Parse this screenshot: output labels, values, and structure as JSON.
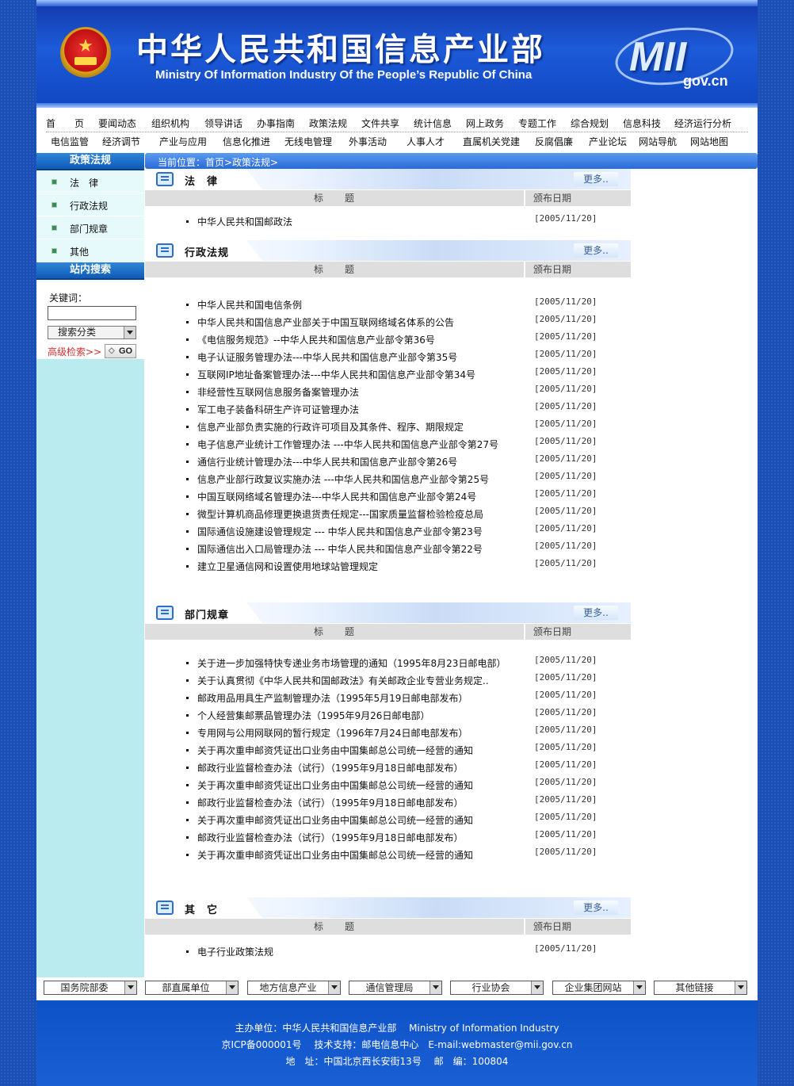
{
  "header": {
    "title_cn": "中华人民共和国信息产业部",
    "title_en": "Ministry Of Information Industry Of the People’s  Republic Of China",
    "logo_text": "MII",
    "logo_domain": "gov.cn"
  },
  "nav": {
    "row1": [
      "首　　页",
      "要闻动态",
      "组织机构",
      "领导讲话",
      "办事指南",
      "政策法规",
      "文件共享",
      "统计信息",
      "网上政务",
      "专题工作",
      "综合规划",
      "信息科技",
      "经济运行分析"
    ],
    "row2": [
      "电信监管",
      "经济调节",
      "产业与应用",
      "信息化推进",
      "无线电管理",
      "外事活动",
      "人事人才",
      "直属机关党建",
      "反腐倡廉",
      "产业论坛",
      "网站导航",
      "网站地图"
    ]
  },
  "breadcrumb": "当前位置：首页>政策法规>",
  "sidebar": {
    "policy_title": "政策法规",
    "items": [
      "法　律",
      "行政法规",
      "部门规章",
      "其他"
    ],
    "search_title": "站内搜索",
    "keyword_label": "关键词：",
    "keyword_value": "",
    "category_select": "搜索分类",
    "advanced_link": "高级检索>>",
    "go_label": "GO"
  },
  "columns": {
    "title": "标　　题",
    "date": "颁布日期"
  },
  "more_label": "更多..",
  "sections": {
    "law": {
      "title": "法　律",
      "rows": [
        {
          "title": "中华人民共和国邮政法",
          "date": "[2005/11/20]"
        }
      ]
    },
    "admin": {
      "title": "行政法规",
      "rows": [
        {
          "title": "中华人民共和国电信条例",
          "date": "[2005/11/20]"
        },
        {
          "title": "中华人民共和国信息产业部关于中国互联网络域名体系的公告",
          "date": "[2005/11/20]"
        },
        {
          "title": "《电信服务规范》--中华人民共和国信息产业部令第36号",
          "date": "[2005/11/20]"
        },
        {
          "title": "电子认证服务管理办法---中华人民共和国信息产业部令第35号",
          "date": "[2005/11/20]"
        },
        {
          "title": "互联网IP地址备案管理办法---中华人民共和国信息产业部令第34号",
          "date": "[2005/11/20]"
        },
        {
          "title": "非经营性互联网信息服务备案管理办法",
          "date": "[2005/11/20]"
        },
        {
          "title": "军工电子装备科研生产许可证管理办法",
          "date": "[2005/11/20]"
        },
        {
          "title": "信息产业部负责实施的行政许可项目及其条件、程序、期限规定",
          "date": "[2005/11/20]"
        },
        {
          "title": "电子信息产业统计工作管理办法 ---中华人民共和国信息产业部令第27号",
          "date": "[2005/11/20]"
        },
        {
          "title": "通信行业统计管理办法---中华人民共和国信息产业部令第26号",
          "date": "[2005/11/20]"
        },
        {
          "title": "信息产业部行政复议实施办法 ---中华人民共和国信息产业部令第25号",
          "date": "[2005/11/20]"
        },
        {
          "title": "中国互联网络域名管理办法---中华人民共和国信息产业部令第24号",
          "date": "[2005/11/20]"
        },
        {
          "title": "微型计算机商品修理更换退货责任规定---国家质量监督检验检疫总局",
          "date": "[2005/11/20]"
        },
        {
          "title": "国际通信设施建设管理规定 --- 中华人民共和国信息产业部令第23号",
          "date": "[2005/11/20]"
        },
        {
          "title": "国际通信出入口局管理办法 --- 中华人民共和国信息产业部令第22号",
          "date": "[2005/11/20]"
        },
        {
          "title": "建立卫星通信网和设置使用地球站管理规定",
          "date": "[2005/11/20]"
        }
      ]
    },
    "dept": {
      "title": "部门规章",
      "rows": [
        {
          "title": "关于进一步加强特快专递业务市场管理的通知（1995年8月23日邮电部）",
          "date": "[2005/11/20]"
        },
        {
          "title": "关于认真贯彻《中华人民共和国邮政法》有关邮政企业专营业务规定..",
          "date": "[2005/11/20]"
        },
        {
          "title": "邮政用品用具生产监制管理办法（1995年5月19日邮电部发布）",
          "date": "[2005/11/20]"
        },
        {
          "title": "个人经营集邮票品管理办法（1995年9月26日邮电部）",
          "date": "[2005/11/20]"
        },
        {
          "title": "专用网与公用网联网的暂行规定（1996年7月24日邮电部发布）",
          "date": "[2005/11/20]"
        },
        {
          "title": "关于再次重申邮资凭证出口业务由中国集邮总公司统一经营的通知",
          "date": "[2005/11/20]"
        },
        {
          "title": "邮政行业监督检查办法（试行）（1995年9月18日邮电部发布）",
          "date": "[2005/11/20]"
        },
        {
          "title": "关于再次重申邮资凭证出口业务由中国集邮总公司统一经营的通知",
          "date": "[2005/11/20]"
        },
        {
          "title": "邮政行业监督检查办法（试行）（1995年9月18日邮电部发布）",
          "date": "[2005/11/20]"
        },
        {
          "title": "关于再次重申邮资凭证出口业务由中国集邮总公司统一经营的通知",
          "date": "[2005/11/20]"
        },
        {
          "title": "邮政行业监督检查办法（试行）（1995年9月18日邮电部发布）",
          "date": "[2005/11/20]"
        },
        {
          "title": "关于再次重申邮资凭证出口业务由中国集邮总公司统一经营的通知",
          "date": "[2005/11/20]"
        }
      ]
    },
    "other": {
      "title": "其　它",
      "rows": [
        {
          "title": "电子行业政策法规",
          "date": "[2005/11/20]"
        }
      ]
    }
  },
  "footer_links": [
    "国务院部委",
    "部直属单位",
    "地方信息产业",
    "通信管理局",
    "行业协会",
    "企业集团网站",
    "其他链接"
  ],
  "footer": {
    "line1": "主办单位：中华人民共和国信息产业部　 Ministry of Information Industry",
    "line2": "京ICP备000001号　 技术支持：邮电信息中心　E-mail:webmaster@mii.gov.cn",
    "line3": "地　址：中国北京西长安街13号　 邮　编：100804"
  },
  "colors": {
    "brand_blue": "#1d5bd9",
    "sidebar_bg": "#b9ebef",
    "advanced_link": "#d03030"
  }
}
